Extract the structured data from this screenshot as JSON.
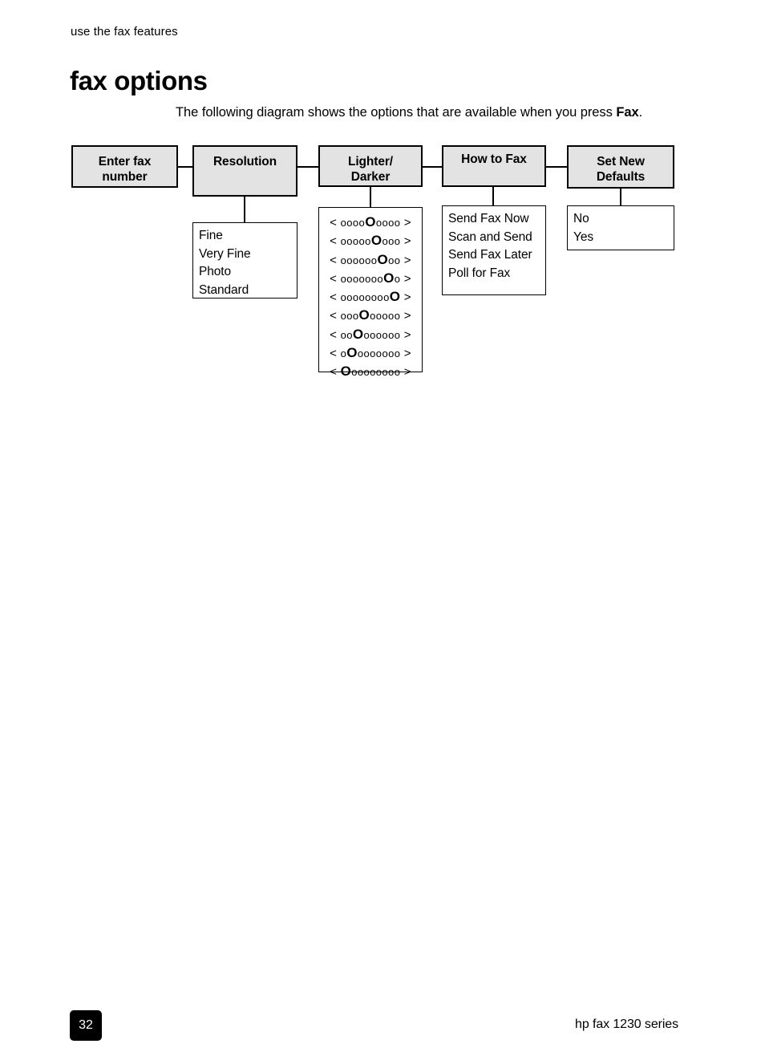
{
  "header": {
    "running_head": "use the fax features",
    "title": "fax options",
    "intro_text_before": "The following diagram shows the options that are available when you press ",
    "intro_emphasis": "Fax",
    "intro_text_after": "."
  },
  "diagram": {
    "nodes": [
      {
        "id": "enter-fax-number",
        "label": "Enter fax\nnumber"
      },
      {
        "id": "resolution",
        "label": "Resolution"
      },
      {
        "id": "lighter-darker",
        "label": "Lighter/\nDarker"
      },
      {
        "id": "how-to-fax",
        "label": "How to Fax"
      },
      {
        "id": "set-new-defaults",
        "label": "Set New\nDefaults"
      }
    ],
    "resolution_options": [
      "Fine",
      "Very Fine",
      "Photo",
      "Standard"
    ],
    "how_to_fax_options": [
      "Send Fax Now",
      "Scan and Send",
      "Send Fax Later",
      "Poll for Fax"
    ],
    "set_new_defaults_options": [
      "No",
      "Yes"
    ],
    "lighter_darker_levels": [
      {
        "left_arrow": "<",
        "dots_before": 4,
        "dots_after": 4,
        "right_arrow": ">"
      },
      {
        "left_arrow": "<",
        "dots_before": 5,
        "dots_after": 3,
        "right_arrow": ">"
      },
      {
        "left_arrow": "<",
        "dots_before": 6,
        "dots_after": 2,
        "right_arrow": ">"
      },
      {
        "left_arrow": "<",
        "dots_before": 7,
        "dots_after": 1,
        "right_arrow": ">"
      },
      {
        "left_arrow": "<",
        "dots_before": 8,
        "dots_after": 0,
        "right_arrow": ">"
      },
      {
        "left_arrow": "<",
        "dots_before": 3,
        "dots_after": 5,
        "right_arrow": ">"
      },
      {
        "left_arrow": "<",
        "dots_before": 2,
        "dots_after": 6,
        "right_arrow": ">"
      },
      {
        "left_arrow": "<",
        "dots_before": 1,
        "dots_after": 7,
        "right_arrow": ">"
      },
      {
        "left_arrow": "<",
        "dots_before": 0,
        "dots_after": 8,
        "right_arrow": ">"
      }
    ],
    "dot_glyph": "o",
    "cursor_glyph": "O",
    "box_fill_color": "#e3e3e3",
    "border_color": "#000000"
  },
  "footer": {
    "page_number": "32",
    "product": "hp fax 1230 series"
  }
}
